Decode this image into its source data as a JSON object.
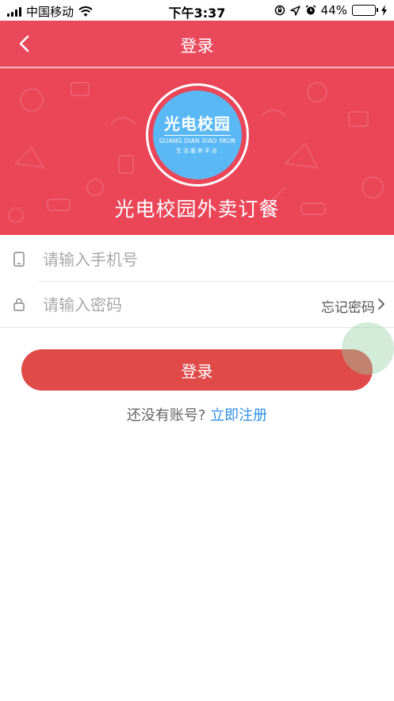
{
  "status_bar": {
    "carrier": "中国移动",
    "time": "下午3:37",
    "battery_percent": "44%",
    "battery_level": 0.44,
    "icons": [
      "signal-icon",
      "wifi-icon",
      "rotation-lock-icon",
      "location-icon",
      "alarm-icon",
      "battery-icon",
      "charging-icon"
    ]
  },
  "nav": {
    "title": "登录",
    "back_icon": "chevron-left-icon"
  },
  "hero": {
    "logo": {
      "title": "光电校园",
      "english": "GUANG DIAN XIAO YAUN",
      "subtitle": "生活服务平台"
    },
    "title": "光电校园外卖订餐"
  },
  "form": {
    "phone": {
      "icon": "phone-icon",
      "placeholder": "请输入手机号",
      "value": ""
    },
    "password": {
      "icon": "lock-icon",
      "placeholder": "请输入密码",
      "value": ""
    },
    "forgot_label": "忘记密码"
  },
  "login_button": {
    "label": "登录"
  },
  "register": {
    "question": "还没有账号?",
    "link": "立即注册"
  },
  "colors": {
    "primary": "#e9495b",
    "button": "#e04a49",
    "logo_blue": "#5ab8f5",
    "link": "#2f8fe6"
  }
}
